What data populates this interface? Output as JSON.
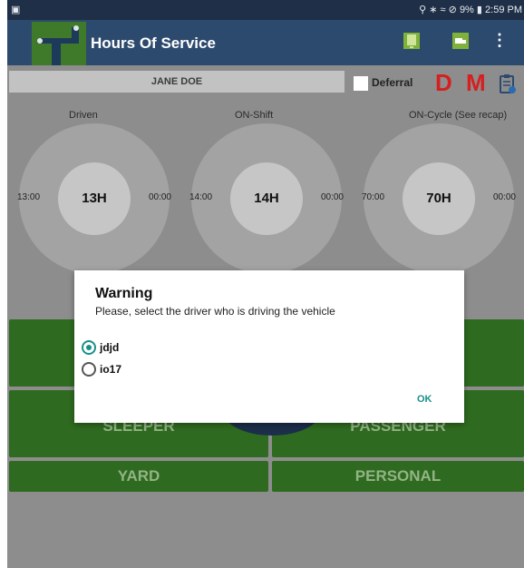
{
  "status_bar": {
    "left_icon": "screenshot-icon",
    "right_text": "9%",
    "time": "2:59 PM"
  },
  "app_bar": {
    "title": "Hours Of Service",
    "icons": [
      "logo-icon",
      "tablet-icon",
      "truck-icon",
      "overflow-menu-icon"
    ]
  },
  "driver": {
    "name": "JANE DOE"
  },
  "deferral": {
    "label": "Deferral",
    "checked": false
  },
  "badges": {
    "d": "D",
    "m": "M"
  },
  "gauges": [
    {
      "label": "Driven",
      "left": "13:00",
      "center": "13H",
      "right": "00:00"
    },
    {
      "label": "ON-Shift",
      "left": "14:00",
      "center": "14H",
      "right": "00:00"
    },
    {
      "label": "ON-Cycle (See recap)",
      "left": "70:00",
      "center": "70H",
      "right": "00:00"
    }
  ],
  "status_buttons": {
    "sleeper": "SLEEPER",
    "passenger": "PASSENGER",
    "yard": "YARD",
    "personal": "PERSONAL"
  },
  "dialog": {
    "title": "Warning",
    "message": "Please, select the driver who is driving the vehicle",
    "options": [
      {
        "label": "jdjd",
        "selected": true
      },
      {
        "label": "io17",
        "selected": false
      }
    ],
    "ok_label": "OK"
  },
  "colors": {
    "app_bar": "#2c4a6e",
    "status_green": "#2e6a20",
    "accent_teal": "#1a8f8a",
    "badge_red": "#d61f1f"
  }
}
